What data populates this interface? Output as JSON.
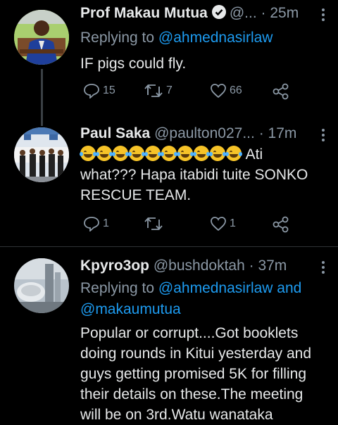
{
  "tweets": [
    {
      "name": "Prof Makau Mutua",
      "handle": "@...",
      "time": "· 25m",
      "verified": true,
      "reply_prefix": "Replying to ",
      "reply_to": "@ahmednasirlaw",
      "text": "IF pigs could fly.",
      "replies": "15",
      "retweets": "7",
      "likes": "66"
    },
    {
      "name": "Paul Saka",
      "handle": "@paulton027...",
      "time": "· 17m",
      "verified": false,
      "emoji_name": "rolling-on-floor-laughing-emoji",
      "emoji_count": 10,
      "text_after_emoji": " Ati",
      "text": "what??? Hapa itabidi tuite SONKO RESCUE TEAM.",
      "replies": "1",
      "retweets": "",
      "likes": "1"
    },
    {
      "name": "Kpyro3op",
      "handle": "@bushdoktah",
      "time": "· 37m",
      "verified": false,
      "reply_prefix": "Replying to ",
      "reply_to": "@ahmednasirlaw and @makaumutua",
      "text": "Popular or corrupt....Got booklets doing rounds in Kitui yesterday and guys getting promised 5K for filling their details on these.The meeting will be on 3rd.Watu wanataka"
    }
  ],
  "icons": {
    "reply": "reply-icon",
    "retweet": "retweet-icon",
    "like": "like-icon",
    "share": "share-icon",
    "more": "more-icon",
    "verified": "verified-icon"
  },
  "colors": {
    "background": "#000000",
    "link": "#1d9bf0",
    "secondary": "#8b98a5"
  }
}
